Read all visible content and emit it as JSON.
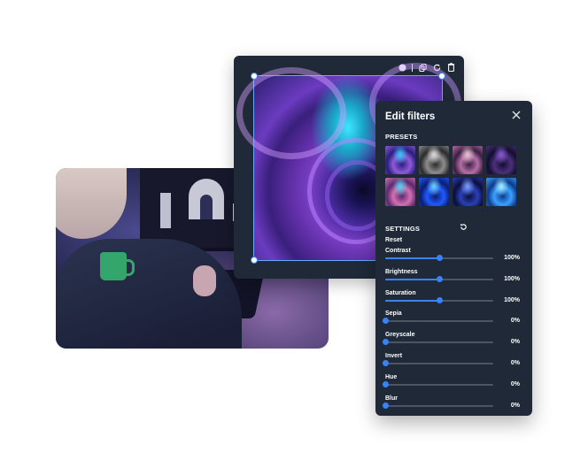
{
  "editor": {
    "toolbar_icons": [
      "circle-icon",
      "copy-icon",
      "rotate-icon",
      "trash-icon"
    ]
  },
  "panel": {
    "title": "Edit filters",
    "presets_label": "PRESETS",
    "settings_label": "SETTINGS",
    "reset_label": "Reset",
    "presets": [
      {
        "gradient": [
          "#2a1f7a",
          "#8e5ad9",
          "#37c6ff"
        ]
      },
      {
        "gradient": [
          "#2b2b2b",
          "#8c8c8c",
          "#dcdcdc"
        ]
      },
      {
        "gradient": [
          "#3a1f3f",
          "#b36fa8",
          "#e9c4d4"
        ]
      },
      {
        "gradient": [
          "#120f2e",
          "#4b2f7a",
          "#8a5bd0"
        ]
      },
      {
        "gradient": [
          "#5a2a6e",
          "#d46fb0",
          "#50d4f0"
        ]
      },
      {
        "gradient": [
          "#0b1d6e",
          "#1f59ff",
          "#6fd4ff"
        ]
      },
      {
        "gradient": [
          "#0a0f3a",
          "#2a3fb6",
          "#7aa0ff"
        ]
      },
      {
        "gradient": [
          "#0e3a8a",
          "#3aa0ff",
          "#a8f0ff"
        ]
      }
    ],
    "settings": [
      {
        "name": "Contrast",
        "value": "100%",
        "level": 0.5
      },
      {
        "name": "Brightness",
        "value": "100%",
        "level": 0.5
      },
      {
        "name": "Saturation",
        "value": "100%",
        "level": 0.5
      },
      {
        "name": "Sepia",
        "value": "0%",
        "level": 0
      },
      {
        "name": "Greyscale",
        "value": "0%",
        "level": 0
      },
      {
        "name": "Invert",
        "value": "0%",
        "level": 0
      },
      {
        "name": "Hue",
        "value": "0%",
        "level": 0
      },
      {
        "name": "Blur",
        "value": "0%",
        "level": 0
      }
    ],
    "colors": {
      "accent": "#3b82f6",
      "panel_bg": "#1f2937",
      "track": "#4b5563"
    }
  }
}
